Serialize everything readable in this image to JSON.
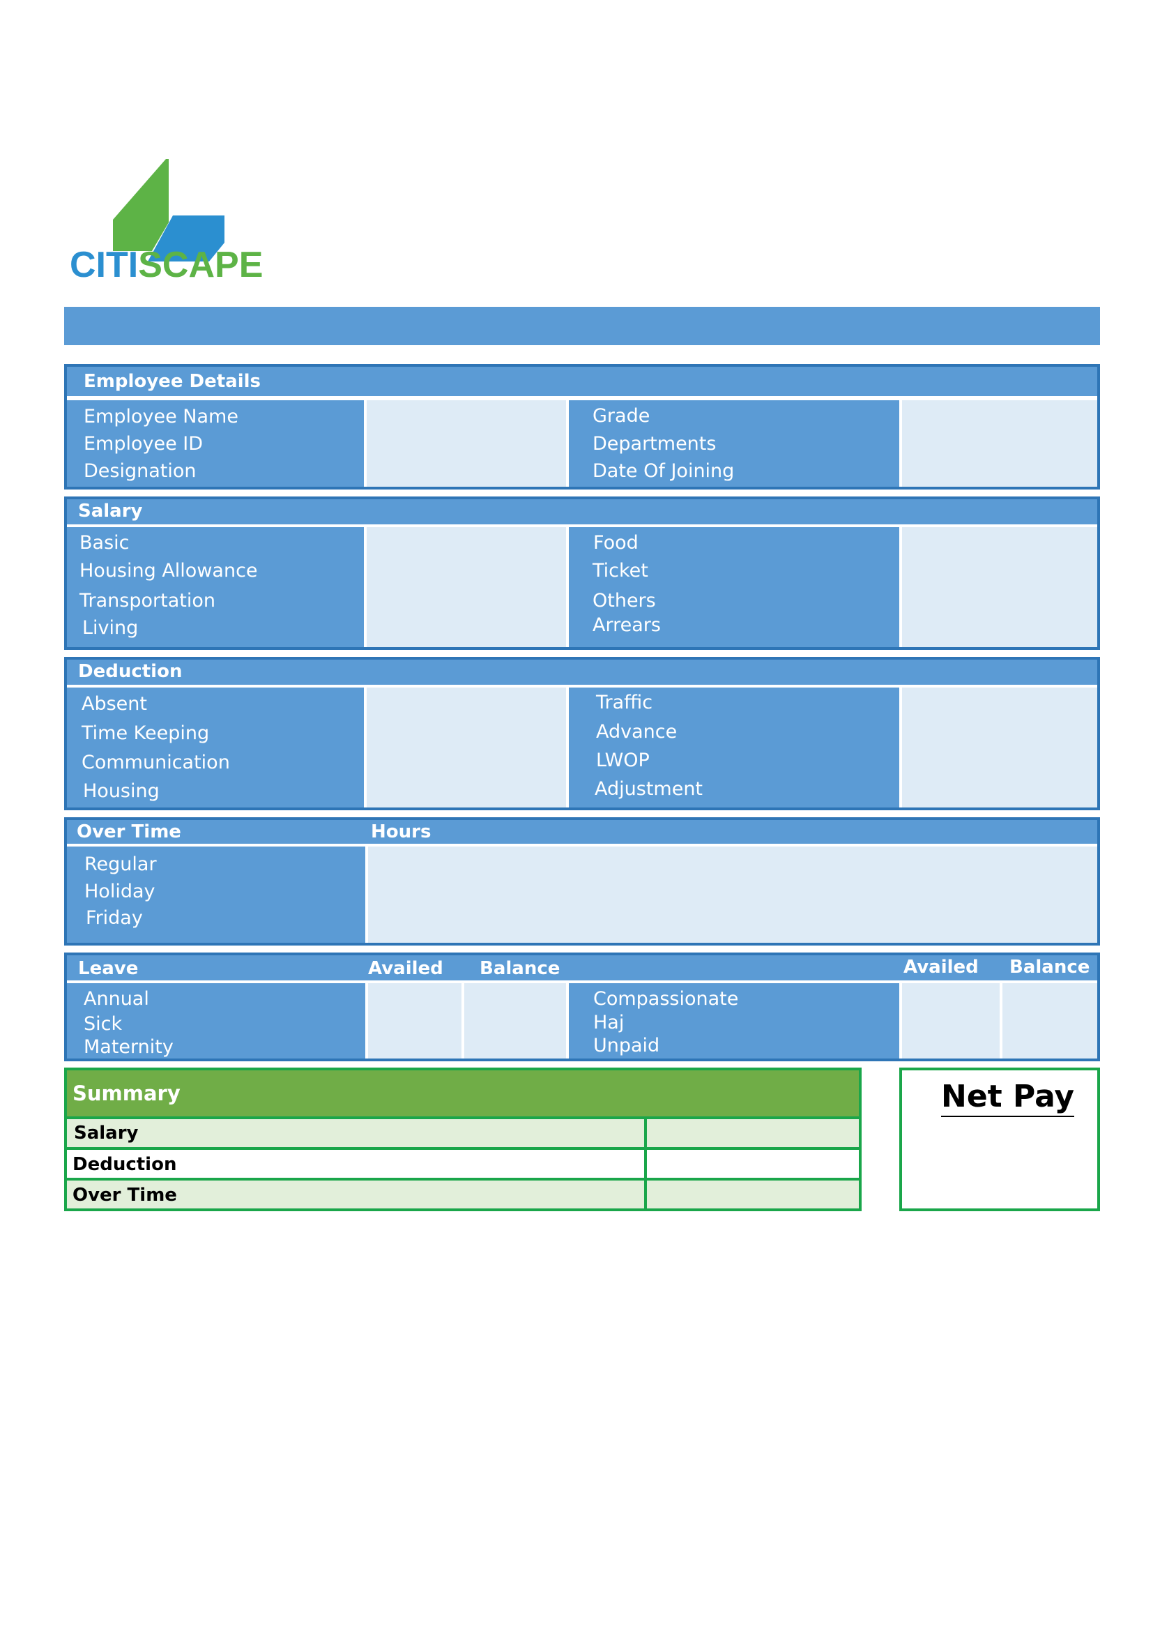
{
  "logo": {
    "part1": "CITI",
    "part2": "SCAPE",
    "blue": "#2b8fd0",
    "green": "#5db346"
  },
  "employee": {
    "title": "Employee Details",
    "left": [
      "Employee Name",
      "Employee ID",
      "Designation"
    ],
    "right": [
      "Grade",
      "Departments",
      "Date Of Joining"
    ]
  },
  "salary": {
    "title": "Salary",
    "left": [
      "Basic",
      "Housing Allowance",
      "Transportation",
      "Living"
    ],
    "right": [
      "Food",
      "Ticket",
      "Others",
      "Arrears"
    ]
  },
  "deduction": {
    "title": "Deduction",
    "left": [
      "Absent",
      "Time Keeping",
      "Communication",
      "Housing"
    ],
    "right": [
      "Traffic",
      "Advance",
      "LWOP",
      "Adjustment"
    ]
  },
  "overtime": {
    "title": "Over Time",
    "hours_label": "Hours",
    "items": [
      "Regular",
      "Holiday",
      "Friday"
    ]
  },
  "leave": {
    "title": "Leave",
    "availed": "Availed",
    "balance": "Balance",
    "left": [
      "Annual",
      "Sick",
      "Maternity"
    ],
    "right": [
      "Compassionate",
      "Haj",
      "Unpaid"
    ]
  },
  "summary": {
    "title": "Summary",
    "rows": [
      "Salary",
      "Deduction",
      "Over Time"
    ]
  },
  "net_pay": "Net Pay",
  "colors": {
    "section_blue": "#5b9bd5",
    "value_cell": "#deebf6",
    "border_blue": "#2e75b6",
    "summary_green": "#70ad47",
    "summary_light": "#e2efda",
    "border_green": "#1aa64a"
  }
}
